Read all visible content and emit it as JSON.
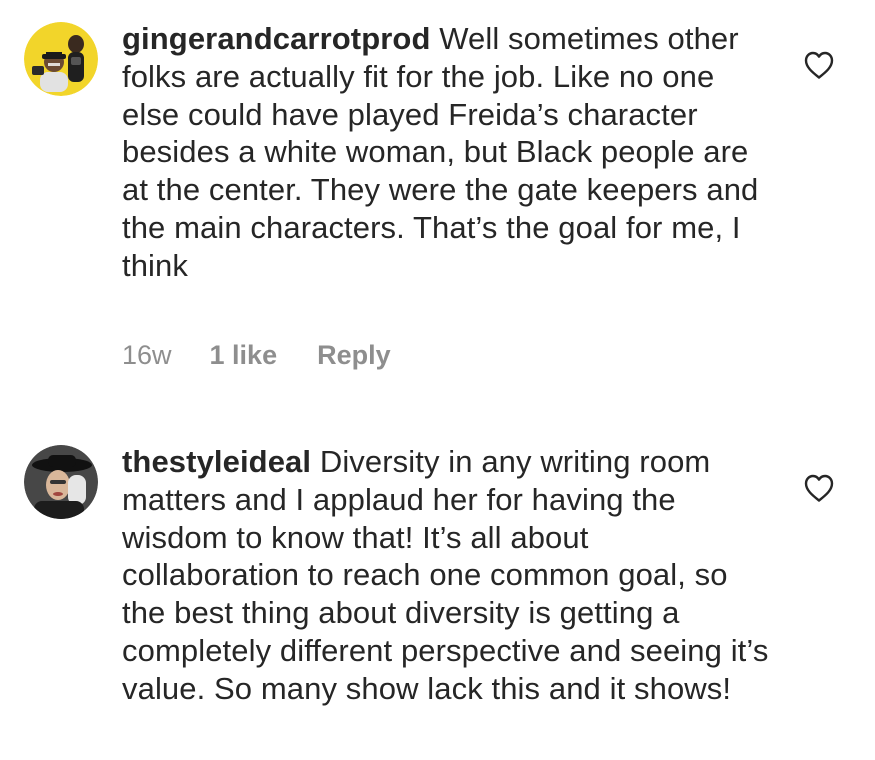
{
  "comments": [
    {
      "username": "gingerandcarrotprod",
      "text": "Well sometimes other folks are actually fit for the job. Like no one else could have played Freida’s character besides a white woman, but Black people are at the center. They were the gate keepers and the main characters. That’s the goal for me, I think",
      "time": "16w",
      "likes": "1 like",
      "reply_label": "Reply",
      "avatar_icon": "avatar-photo",
      "like_icon": "heart-outline-icon"
    },
    {
      "username": "thestyleideal",
      "text": "Diversity in any writing room matters and I applaud her for having the wisdom to know that! It’s all about collaboration to reach one common goal, so the best thing about diversity is getting a completely different perspective and seeing it’s value. So many show lack this and it shows!",
      "avatar_icon": "avatar-photo",
      "like_icon": "heart-outline-icon"
    }
  ],
  "colors": {
    "text": "#262626",
    "meta": "#8e8e8e",
    "avatar1_bg": "#f2d52a",
    "avatar2_bg": "#2b2b2b"
  }
}
